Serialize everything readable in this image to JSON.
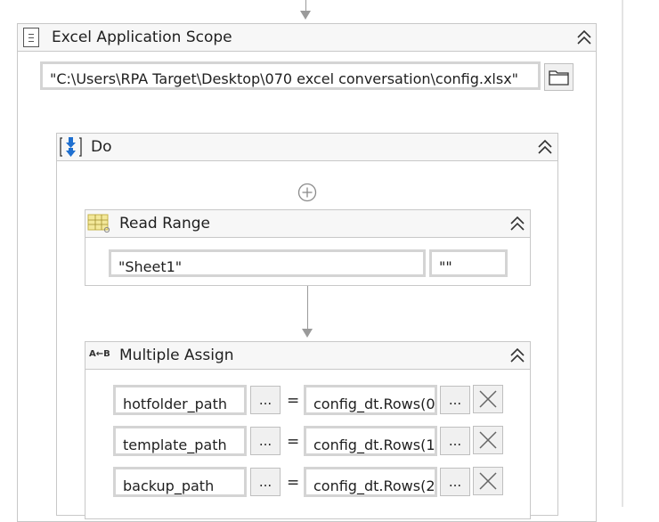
{
  "excel_scope": {
    "title": "Excel Application Scope",
    "workbook_path": "\"C:\\Users\\RPA Target\\Desktop\\070 excel conversation\\config.xlsx\""
  },
  "do_sequence": {
    "title": "Do"
  },
  "read_range": {
    "title": "Read Range",
    "sheet_name": "\"Sheet1\"",
    "range": "\"\""
  },
  "multiple_assign": {
    "title": "Multiple Assign",
    "icon_label": "A←B",
    "equals": "=",
    "ellipsis": "...",
    "rows": [
      {
        "to": "hotfolder_path",
        "value": "config_dt.Rows(0"
      },
      {
        "to": "template_path",
        "value": "config_dt.Rows(1"
      },
      {
        "to": "backup_path",
        "value": "config_dt.Rows(2"
      }
    ]
  },
  "colors": {
    "accent_blue": "#1e6fd0",
    "border": "#c8c8c8",
    "connector": "#9a9a9a"
  }
}
